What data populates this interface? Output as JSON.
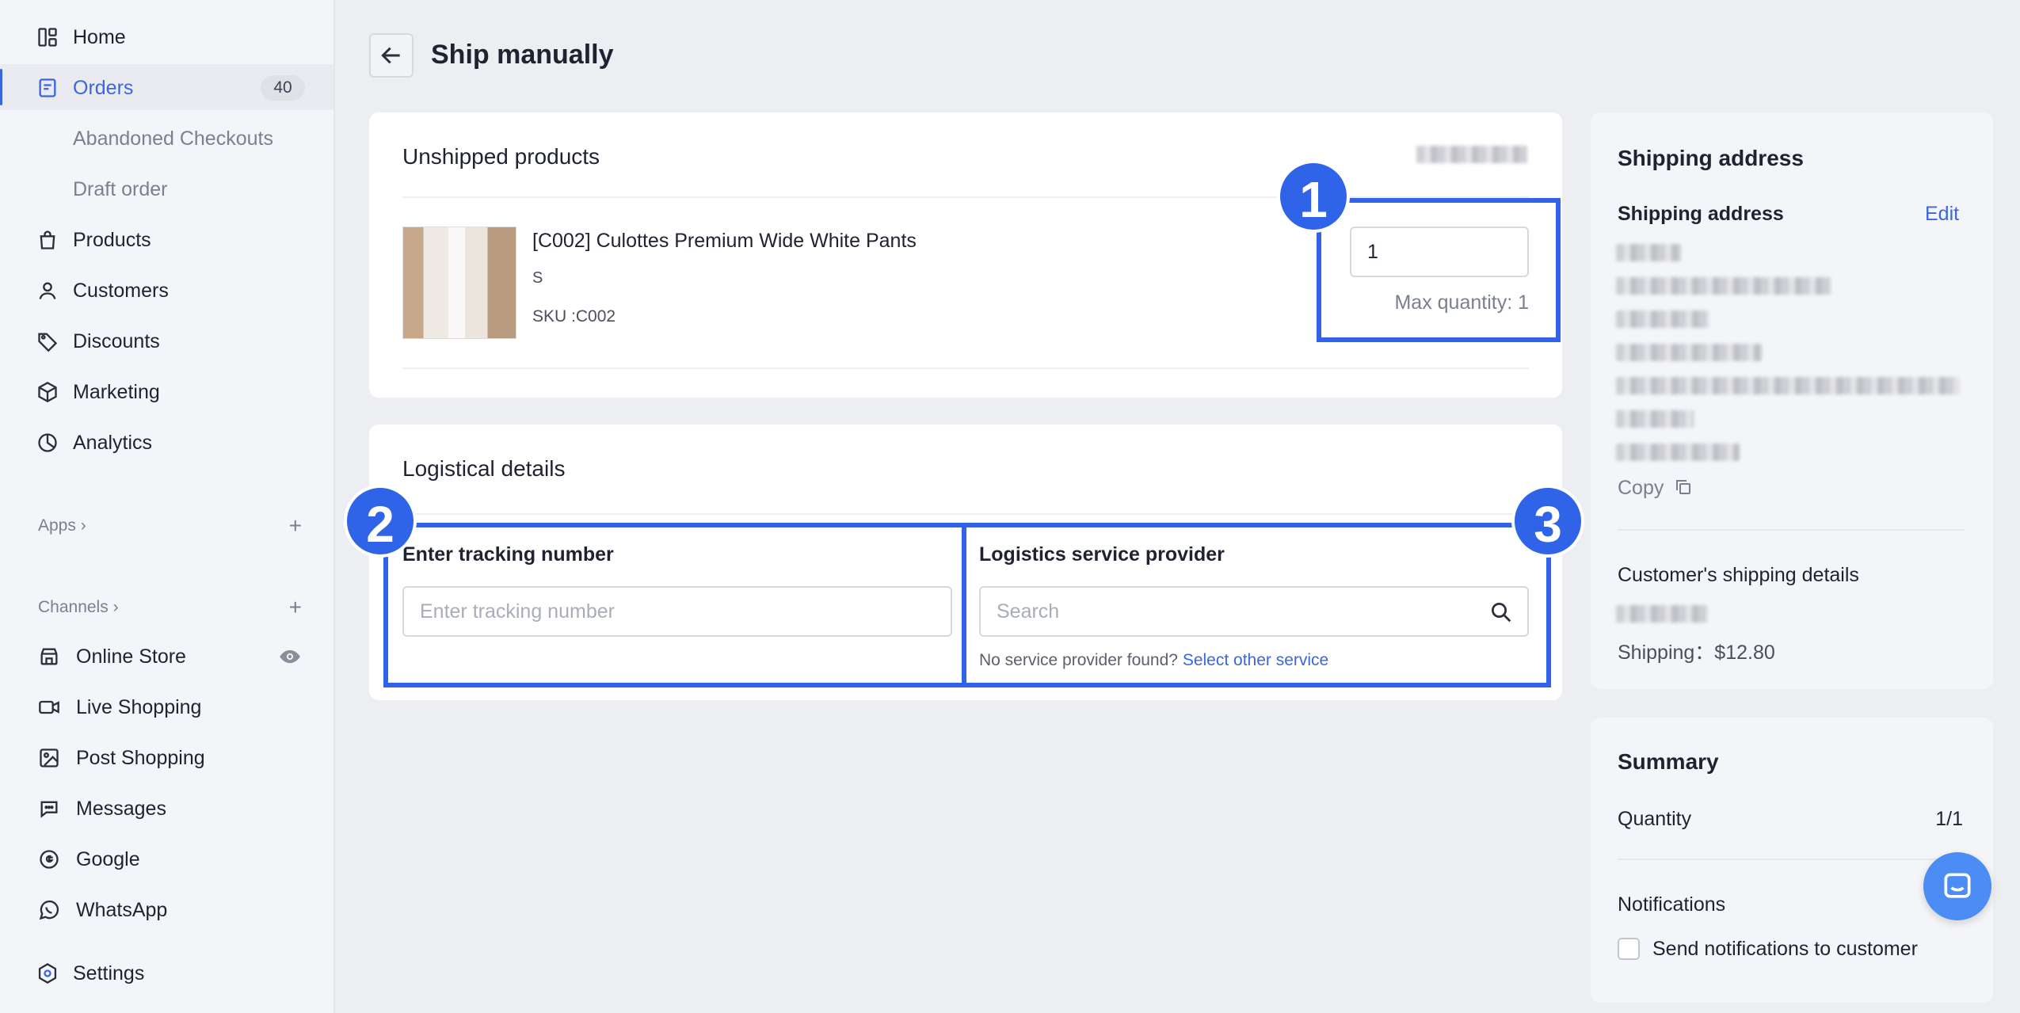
{
  "sidebar": {
    "items": [
      {
        "label": "Home",
        "icon": "home-icon"
      },
      {
        "label": "Orders",
        "icon": "orders-icon",
        "badge": "40"
      },
      {
        "label": "Abandoned Checkouts"
      },
      {
        "label": "Draft order"
      },
      {
        "label": "Products",
        "icon": "products-icon"
      },
      {
        "label": "Customers",
        "icon": "customers-icon"
      },
      {
        "label": "Discounts",
        "icon": "discounts-icon"
      },
      {
        "label": "Marketing",
        "icon": "marketing-icon"
      },
      {
        "label": "Analytics",
        "icon": "analytics-icon"
      }
    ],
    "apps_label": "Apps",
    "channels_label": "Channels",
    "channels": [
      {
        "label": "Online Store",
        "icon": "online-store-icon"
      },
      {
        "label": "Live Shopping",
        "icon": "live-shopping-icon"
      },
      {
        "label": "Post Shopping",
        "icon": "post-shopping-icon"
      },
      {
        "label": "Messages",
        "icon": "messages-icon"
      },
      {
        "label": "Google",
        "icon": "google-icon"
      },
      {
        "label": "WhatsApp",
        "icon": "whatsapp-icon"
      }
    ],
    "settings_label": "Settings"
  },
  "header": {
    "title": "Ship manually"
  },
  "unshipped": {
    "title": "Unshipped products",
    "product": {
      "name": "[C002] Culottes Premium Wide White Pants",
      "variant": "S",
      "sku": "SKU :C002",
      "quantity": "1",
      "max_quantity": "Max quantity: 1"
    }
  },
  "logistics": {
    "title": "Logistical details",
    "tracking_label": "Enter tracking number",
    "tracking_placeholder": "Enter tracking number",
    "provider_label": "Logistics service provider",
    "provider_placeholder": "Search",
    "hint_text": "No service provider found?",
    "hint_link": "Select other service"
  },
  "shipping_address": {
    "card_title": "Shipping address",
    "section_label": "Shipping address",
    "edit_label": "Edit",
    "copy_label": "Copy",
    "customer_details_label": "Customer's shipping details",
    "shipping_cost": "Shipping：$12.80"
  },
  "summary": {
    "title": "Summary",
    "quantity_label": "Quantity",
    "quantity_value": "1/1",
    "notifications_label": "Notifications",
    "send_notifications_label": "Send notifications to customer"
  },
  "annotations": [
    "1",
    "2",
    "3"
  ],
  "colors": {
    "accent": "#3a66e0",
    "highlight": "#2f63e8",
    "chat": "#4c8cf5"
  }
}
